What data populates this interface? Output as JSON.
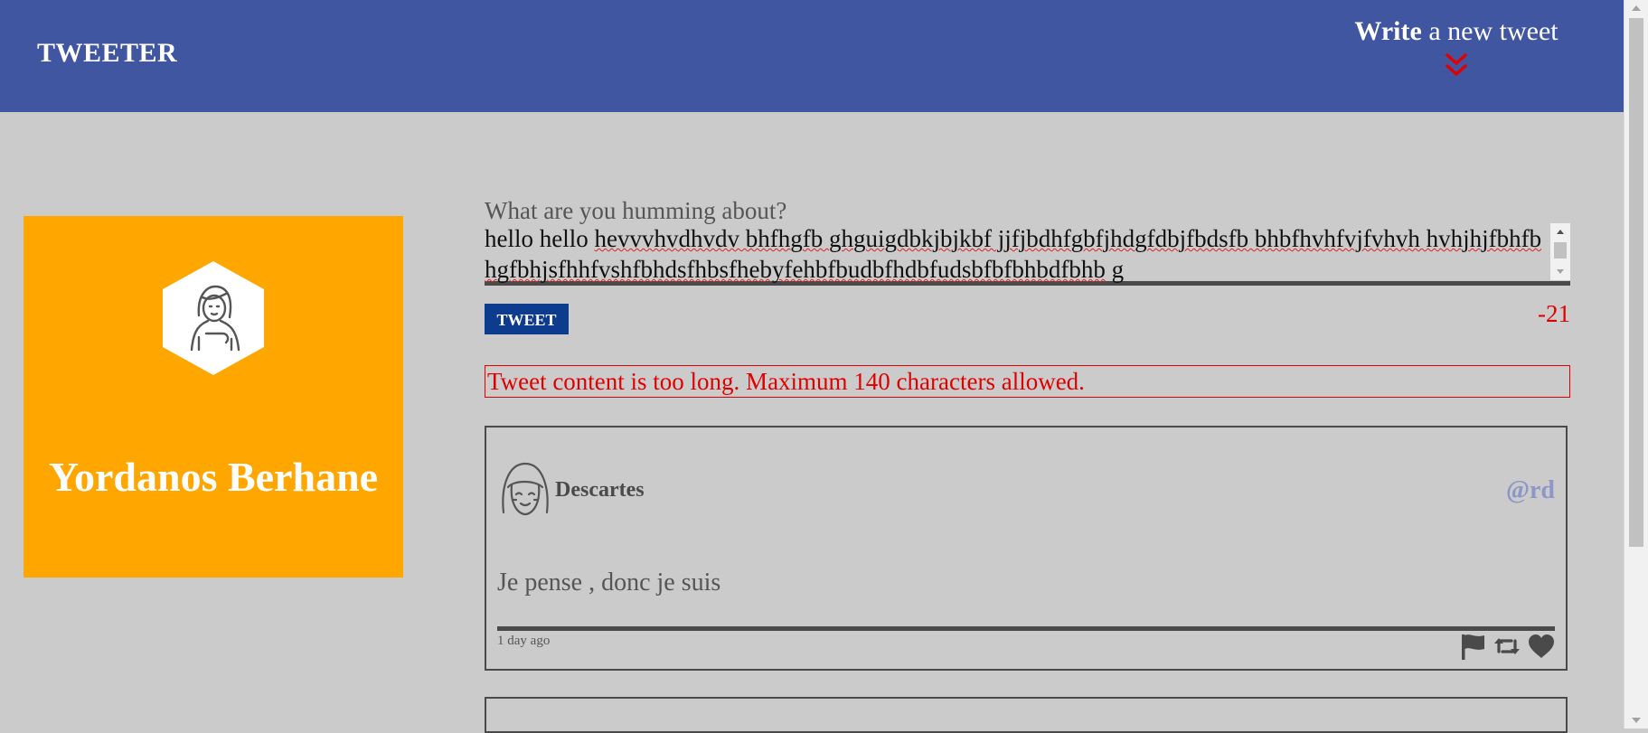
{
  "nav": {
    "brand": "TWEETER",
    "write_bold": "Write",
    "write_rest": " a new tweet",
    "chevron_icon": "double-chevron-down-icon",
    "chevron_color": "#e00000",
    "bg_color": "#4056a1"
  },
  "profile": {
    "name": "Yordanos Berhane",
    "avatar_icon": "user-avatar-icon",
    "bg_color": "#ffa600"
  },
  "compose": {
    "label": "What are you humming about?",
    "value_plain": "hello hello ",
    "value_misspelled": "hevvvhvdhvdv bhfhgfb ghguigdbkjbjkbf jjfjbdhfgbfjhdgfdbjfbdsfb bhbfhvhfvjfvhvh hvhjhjfbhfbhgfbhjsfhhfvshfbhdsfhbsfhebyfehbfbudbfhdbfudsbfbfbhbdfbhb",
    "value_tail": " g",
    "tweet_button": "TWEET",
    "counter": "-21",
    "error": "Tweet content is too long. Maximum 140 characters allowed."
  },
  "tweets": [
    {
      "name": "Descartes",
      "handle": "@rd",
      "content": "Je pense , donc je suis",
      "time": "1 day ago",
      "avatar_icon": "user-avatar-icon",
      "actions": [
        "flag-icon",
        "retweet-icon",
        "heart-icon"
      ]
    }
  ]
}
